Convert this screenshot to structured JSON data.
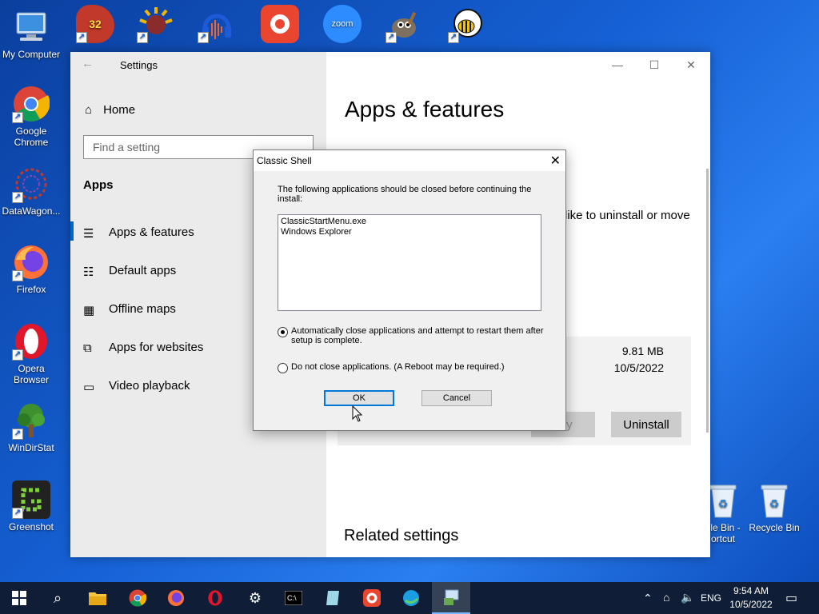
{
  "desktop": {
    "icons_left": [
      {
        "label": "My Computer"
      },
      {
        "label": "Google\nChrome"
      },
      {
        "label": "DataWagon..."
      },
      {
        "label": "Firefox"
      },
      {
        "label": "Opera\nBrowser"
      },
      {
        "label": "WinDirStat"
      },
      {
        "label": "Greenshot"
      }
    ],
    "icons_top": [
      {
        "badge": "32"
      },
      {
        "badge": ""
      },
      {
        "badge": ""
      },
      {
        "badge": ""
      },
      {
        "badge": "zoom"
      },
      {
        "badge": ""
      },
      {
        "badge": ""
      }
    ],
    "recycle_shortcut": "cle Bin -\nortcut",
    "recycle_bin": "Recycle Bin"
  },
  "settings": {
    "window_title": "Settings",
    "home": "Home",
    "search_placeholder": "Find a setting",
    "section": "Apps",
    "nav": [
      {
        "label": "Apps & features"
      },
      {
        "label": "Default apps"
      },
      {
        "label": "Offline maps"
      },
      {
        "label": "Apps for websites"
      },
      {
        "label": "Video playback"
      }
    ],
    "page_title": "Apps & features",
    "fragment_text": "like to uninstall or move",
    "app_size": "9.81 MB",
    "app_date": "10/5/2022",
    "modify_label": "dify",
    "uninstall_label": "Uninstall",
    "related_settings": "Related settings"
  },
  "dialog": {
    "title": "Classic Shell",
    "message": "The following applications should be closed before continuing the install:",
    "apps": [
      "ClassicStartMenu.exe",
      "Windows Explorer"
    ],
    "option_auto": "Automatically close applications and attempt to restart them after setup is complete.",
    "option_none": "Do not close applications. (A Reboot may be required.)",
    "ok_label": "OK",
    "cancel_label": "Cancel"
  },
  "taskbar": {
    "language": "ENG",
    "time": "9:54 AM",
    "date": "10/5/2022"
  }
}
